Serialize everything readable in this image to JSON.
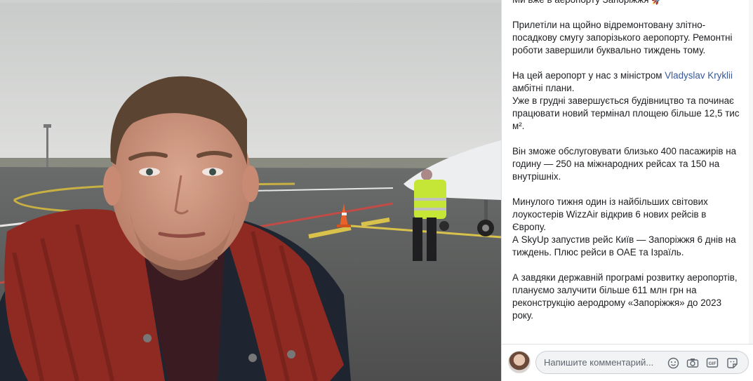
{
  "post": {
    "paragraphs": [
      "Ми вже в аеропорту Запоріжжя 🚀",
      "Прилетіли на щойно відремонтовану злітно-посадкову смугу запорізького аеропорту. Ремонтні роботи завершили буквально тиждень тому.",
      null,
      "Він зможе обслуговувати близько 400 пасажирів на годину — 250 на міжнародних рейсах та 150 на внутрішніх.",
      "Минулого тижня один із найбільших світових лоукостерів WizzAir відкрив 6 нових рейсів в Європу.\nА SkyUp запустив рейс Київ — Запоріжжя 6 днів на тиждень. Плюс рейси в ОАЕ та Ізраїль.",
      "А завдяки державній програмі розвитку аеропортів, плануємо залучити більше 611 млн грн на реконструкцію аеродрому «Запоріжжя» до 2023 року."
    ],
    "mention_para": {
      "before": "На цей аеропорт у нас з міністром ",
      "mention": "Vladyslav Kryklii",
      "after": " амбітні плани.\nУже в грудні завершується будівництво та починає працювати новий термінал площею більше 12,5 тис м²."
    }
  },
  "comment": {
    "placeholder": "Напишите комментарий...",
    "icons": [
      "emoji-icon",
      "camera-icon",
      "gif-icon",
      "sticker-icon"
    ]
  },
  "colors": {
    "mention": "#385898",
    "text": "#1c1e21",
    "vest": "#c6e637",
    "scarf": "#8e2a22"
  }
}
